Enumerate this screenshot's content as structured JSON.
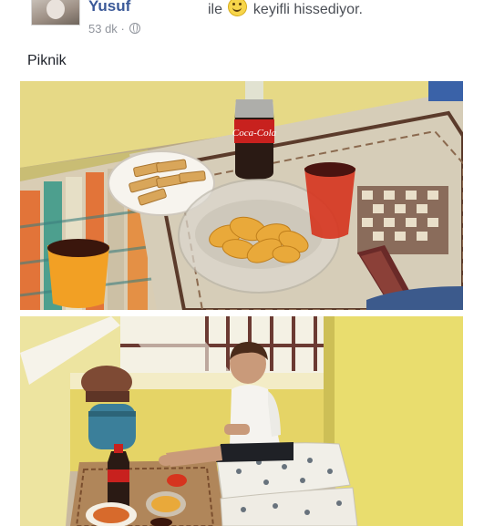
{
  "post": {
    "author": "Yusuf",
    "author_mark": "'",
    "feeling_prefix": "ile",
    "feeling_text": "keyifli hissediyor.",
    "time": "53 dk",
    "separator": "·",
    "caption": "Piknik"
  },
  "icons": {
    "feeling": "smiley-emoji-icon",
    "privacy": "globe-icon"
  },
  "photos": {
    "top": {
      "bottle_label": "Coca-Cola"
    }
  }
}
